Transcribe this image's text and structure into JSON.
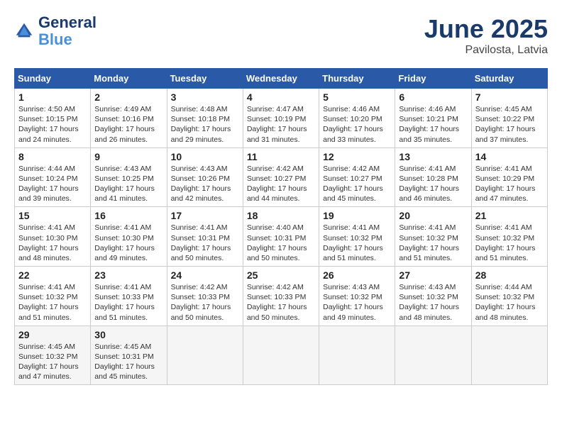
{
  "header": {
    "logo_line1": "General",
    "logo_line2": "Blue",
    "title": "June 2025",
    "subtitle": "Pavilosta, Latvia"
  },
  "calendar": {
    "days_of_week": [
      "Sunday",
      "Monday",
      "Tuesday",
      "Wednesday",
      "Thursday",
      "Friday",
      "Saturday"
    ],
    "weeks": [
      [
        null,
        {
          "day": 2,
          "info": "Sunrise: 4:49 AM\nSunset: 10:16 PM\nDaylight: 17 hours\nand 26 minutes."
        },
        {
          "day": 3,
          "info": "Sunrise: 4:48 AM\nSunset: 10:18 PM\nDaylight: 17 hours\nand 29 minutes."
        },
        {
          "day": 4,
          "info": "Sunrise: 4:47 AM\nSunset: 10:19 PM\nDaylight: 17 hours\nand 31 minutes."
        },
        {
          "day": 5,
          "info": "Sunrise: 4:46 AM\nSunset: 10:20 PM\nDaylight: 17 hours\nand 33 minutes."
        },
        {
          "day": 6,
          "info": "Sunrise: 4:46 AM\nSunset: 10:21 PM\nDaylight: 17 hours\nand 35 minutes."
        },
        {
          "day": 7,
          "info": "Sunrise: 4:45 AM\nSunset: 10:22 PM\nDaylight: 17 hours\nand 37 minutes."
        }
      ],
      [
        {
          "day": 8,
          "info": "Sunrise: 4:44 AM\nSunset: 10:24 PM\nDaylight: 17 hours\nand 39 minutes."
        },
        {
          "day": 9,
          "info": "Sunrise: 4:43 AM\nSunset: 10:25 PM\nDaylight: 17 hours\nand 41 minutes."
        },
        {
          "day": 10,
          "info": "Sunrise: 4:43 AM\nSunset: 10:26 PM\nDaylight: 17 hours\nand 42 minutes."
        },
        {
          "day": 11,
          "info": "Sunrise: 4:42 AM\nSunset: 10:27 PM\nDaylight: 17 hours\nand 44 minutes."
        },
        {
          "day": 12,
          "info": "Sunrise: 4:42 AM\nSunset: 10:27 PM\nDaylight: 17 hours\nand 45 minutes."
        },
        {
          "day": 13,
          "info": "Sunrise: 4:41 AM\nSunset: 10:28 PM\nDaylight: 17 hours\nand 46 minutes."
        },
        {
          "day": 14,
          "info": "Sunrise: 4:41 AM\nSunset: 10:29 PM\nDaylight: 17 hours\nand 47 minutes."
        }
      ],
      [
        {
          "day": 15,
          "info": "Sunrise: 4:41 AM\nSunset: 10:30 PM\nDaylight: 17 hours\nand 48 minutes."
        },
        {
          "day": 16,
          "info": "Sunrise: 4:41 AM\nSunset: 10:30 PM\nDaylight: 17 hours\nand 49 minutes."
        },
        {
          "day": 17,
          "info": "Sunrise: 4:41 AM\nSunset: 10:31 PM\nDaylight: 17 hours\nand 50 minutes."
        },
        {
          "day": 18,
          "info": "Sunrise: 4:40 AM\nSunset: 10:31 PM\nDaylight: 17 hours\nand 50 minutes."
        },
        {
          "day": 19,
          "info": "Sunrise: 4:41 AM\nSunset: 10:32 PM\nDaylight: 17 hours\nand 51 minutes."
        },
        {
          "day": 20,
          "info": "Sunrise: 4:41 AM\nSunset: 10:32 PM\nDaylight: 17 hours\nand 51 minutes."
        },
        {
          "day": 21,
          "info": "Sunrise: 4:41 AM\nSunset: 10:32 PM\nDaylight: 17 hours\nand 51 minutes."
        }
      ],
      [
        {
          "day": 22,
          "info": "Sunrise: 4:41 AM\nSunset: 10:32 PM\nDaylight: 17 hours\nand 51 minutes."
        },
        {
          "day": 23,
          "info": "Sunrise: 4:41 AM\nSunset: 10:33 PM\nDaylight: 17 hours\nand 51 minutes."
        },
        {
          "day": 24,
          "info": "Sunrise: 4:42 AM\nSunset: 10:33 PM\nDaylight: 17 hours\nand 50 minutes."
        },
        {
          "day": 25,
          "info": "Sunrise: 4:42 AM\nSunset: 10:33 PM\nDaylight: 17 hours\nand 50 minutes."
        },
        {
          "day": 26,
          "info": "Sunrise: 4:43 AM\nSunset: 10:32 PM\nDaylight: 17 hours\nand 49 minutes."
        },
        {
          "day": 27,
          "info": "Sunrise: 4:43 AM\nSunset: 10:32 PM\nDaylight: 17 hours\nand 48 minutes."
        },
        {
          "day": 28,
          "info": "Sunrise: 4:44 AM\nSunset: 10:32 PM\nDaylight: 17 hours\nand 48 minutes."
        }
      ],
      [
        {
          "day": 29,
          "info": "Sunrise: 4:45 AM\nSunset: 10:32 PM\nDaylight: 17 hours\nand 47 minutes."
        },
        {
          "day": 30,
          "info": "Sunrise: 4:45 AM\nSunset: 10:31 PM\nDaylight: 17 hours\nand 45 minutes."
        },
        null,
        null,
        null,
        null,
        null
      ]
    ],
    "week0_sunday": {
      "day": 1,
      "info": "Sunrise: 4:50 AM\nSunset: 10:15 PM\nDaylight: 17 hours\nand 24 minutes."
    }
  }
}
